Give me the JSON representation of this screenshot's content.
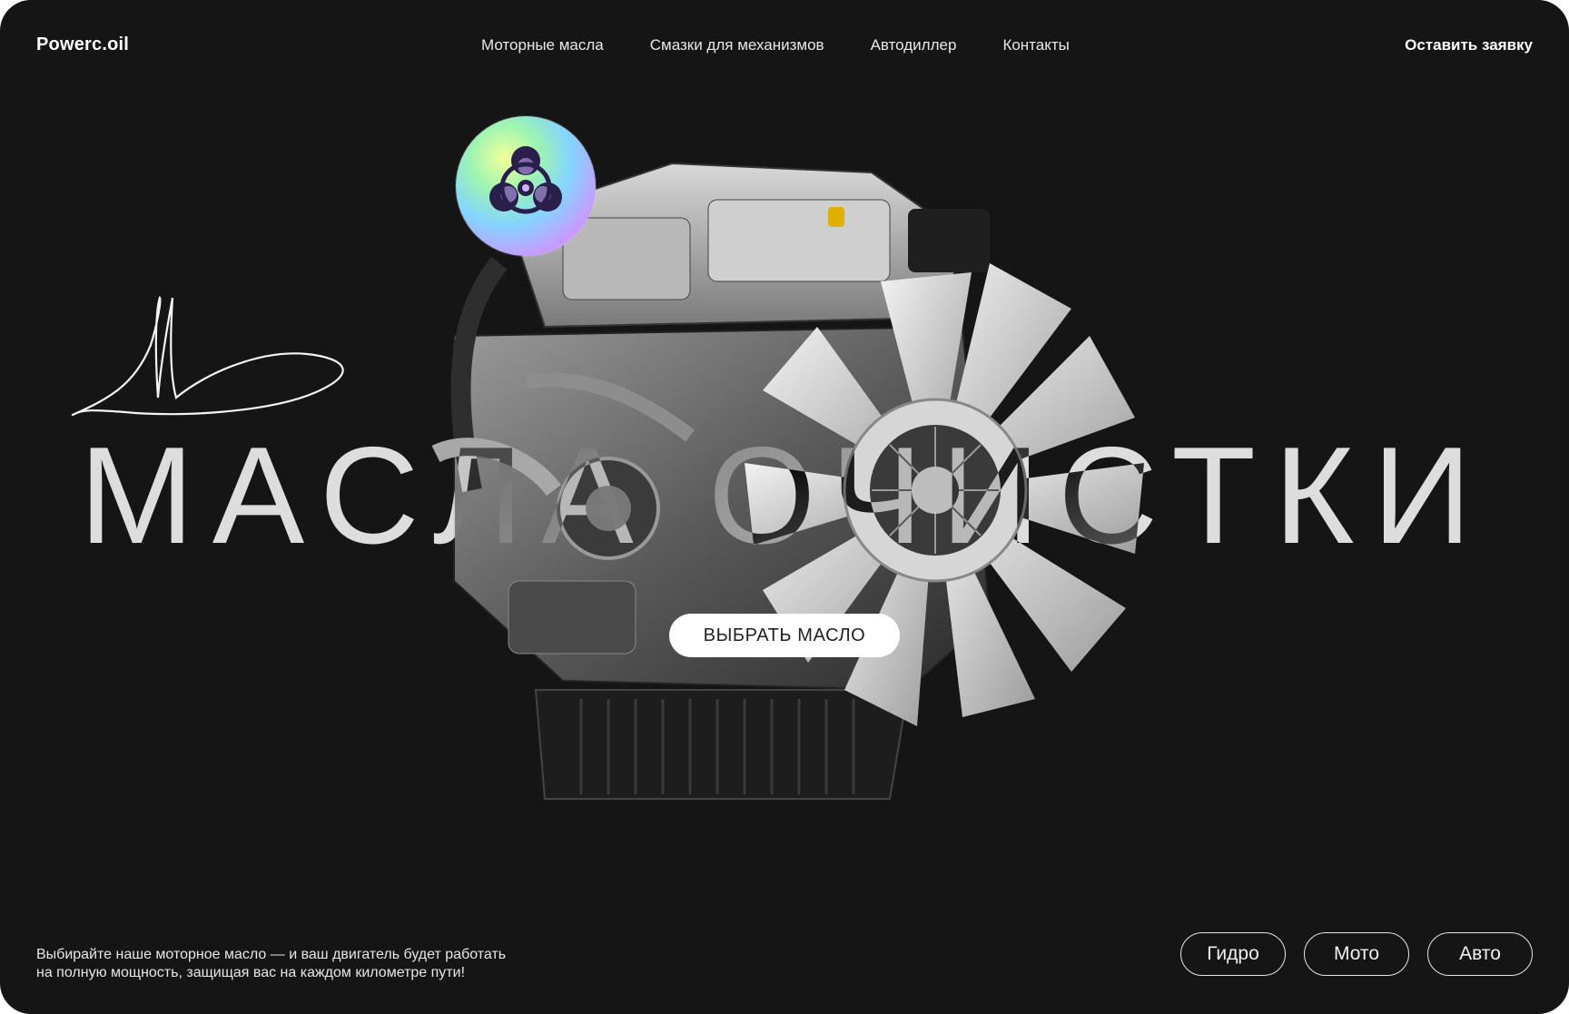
{
  "brand": {
    "logo": "Powerc.oil"
  },
  "nav": {
    "items": [
      {
        "label": "Моторные масла"
      },
      {
        "label": "Смазки для механизмов"
      },
      {
        "label": "Автодиллер"
      },
      {
        "label": "Контакты"
      }
    ],
    "cta": "Оставить заявку"
  },
  "hero": {
    "headline": "МАСЛА ОЧИСТКИ",
    "button": "ВЫБРАТЬ МАСЛО",
    "badge_icon": "biohazard-icon",
    "image_subject": "engine-image"
  },
  "footer": {
    "text_line1": "Выбирайте наше моторное масло — и ваш двигатель будет работать",
    "text_line2": "на полную мощность, защищая вас на каждом километре пути!",
    "chips": [
      {
        "label": "Гидро"
      },
      {
        "label": "Мото"
      },
      {
        "label": "Авто"
      }
    ]
  },
  "colors": {
    "background": "#151515",
    "text": "#ffffff",
    "button_bg": "#ffffff"
  }
}
